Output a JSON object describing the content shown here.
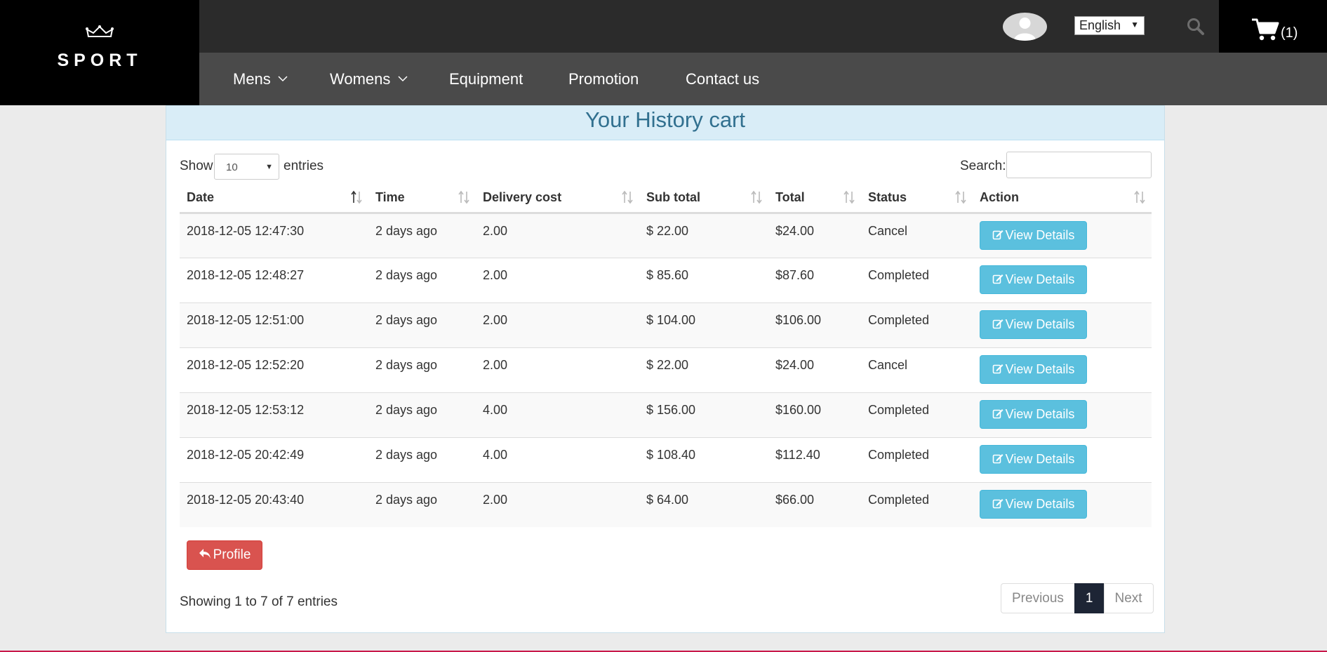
{
  "brand": {
    "name": "SPORT"
  },
  "topbar": {
    "language": "English",
    "cart_count": "(1)"
  },
  "nav": {
    "items": [
      {
        "label": "Mens",
        "dropdown": true
      },
      {
        "label": "Womens",
        "dropdown": true
      },
      {
        "label": "Equipment",
        "dropdown": false
      },
      {
        "label": "Promotion",
        "dropdown": false
      },
      {
        "label": "Contact us",
        "dropdown": false
      }
    ]
  },
  "panel": {
    "title": "Your History cart",
    "show_label": "Show",
    "length_value": "10",
    "entries_label": "entries",
    "search_label": "Search:",
    "search_value": ""
  },
  "table": {
    "headers": [
      "Date",
      "Time",
      "Delivery cost",
      "Sub total",
      "Total",
      "Status",
      "Action"
    ],
    "rows": [
      {
        "date": "2018-12-05 12:47:30",
        "time": "2 days ago",
        "delivery": "2.00",
        "subtotal": "$ 22.00",
        "total": "$24.00",
        "status": "Cancel",
        "action": "View Details"
      },
      {
        "date": "2018-12-05 12:48:27",
        "time": "2 days ago",
        "delivery": "2.00",
        "subtotal": "$ 85.60",
        "total": "$87.60",
        "status": "Completed",
        "action": "View Details"
      },
      {
        "date": "2018-12-05 12:51:00",
        "time": "2 days ago",
        "delivery": "2.00",
        "subtotal": "$ 104.00",
        "total": "$106.00",
        "status": "Completed",
        "action": "View Details"
      },
      {
        "date": "2018-12-05 12:52:20",
        "time": "2 days ago",
        "delivery": "2.00",
        "subtotal": "$ 22.00",
        "total": "$24.00",
        "status": "Cancel",
        "action": "View Details"
      },
      {
        "date": "2018-12-05 12:53:12",
        "time": "2 days ago",
        "delivery": "4.00",
        "subtotal": "$ 156.00",
        "total": "$160.00",
        "status": "Completed",
        "action": "View Details"
      },
      {
        "date": "2018-12-05 20:42:49",
        "time": "2 days ago",
        "delivery": "4.00",
        "subtotal": "$ 108.40",
        "total": "$112.40",
        "status": "Completed",
        "action": "View Details"
      },
      {
        "date": "2018-12-05 20:43:40",
        "time": "2 days ago",
        "delivery": "2.00",
        "subtotal": "$ 64.00",
        "total": "$66.00",
        "status": "Completed",
        "action": "View Details"
      }
    ]
  },
  "footer": {
    "profile_button": "Profile",
    "info": "Showing 1 to 7 of 7 entries",
    "pagination": {
      "previous": "Previous",
      "current": "1",
      "next": "Next"
    }
  },
  "colors": {
    "view_button": "#5bc0de",
    "profile_button": "#d9534f",
    "heading_bg": "#d9edf7",
    "heading_text": "#31708f",
    "active_page": "#1d2535"
  }
}
